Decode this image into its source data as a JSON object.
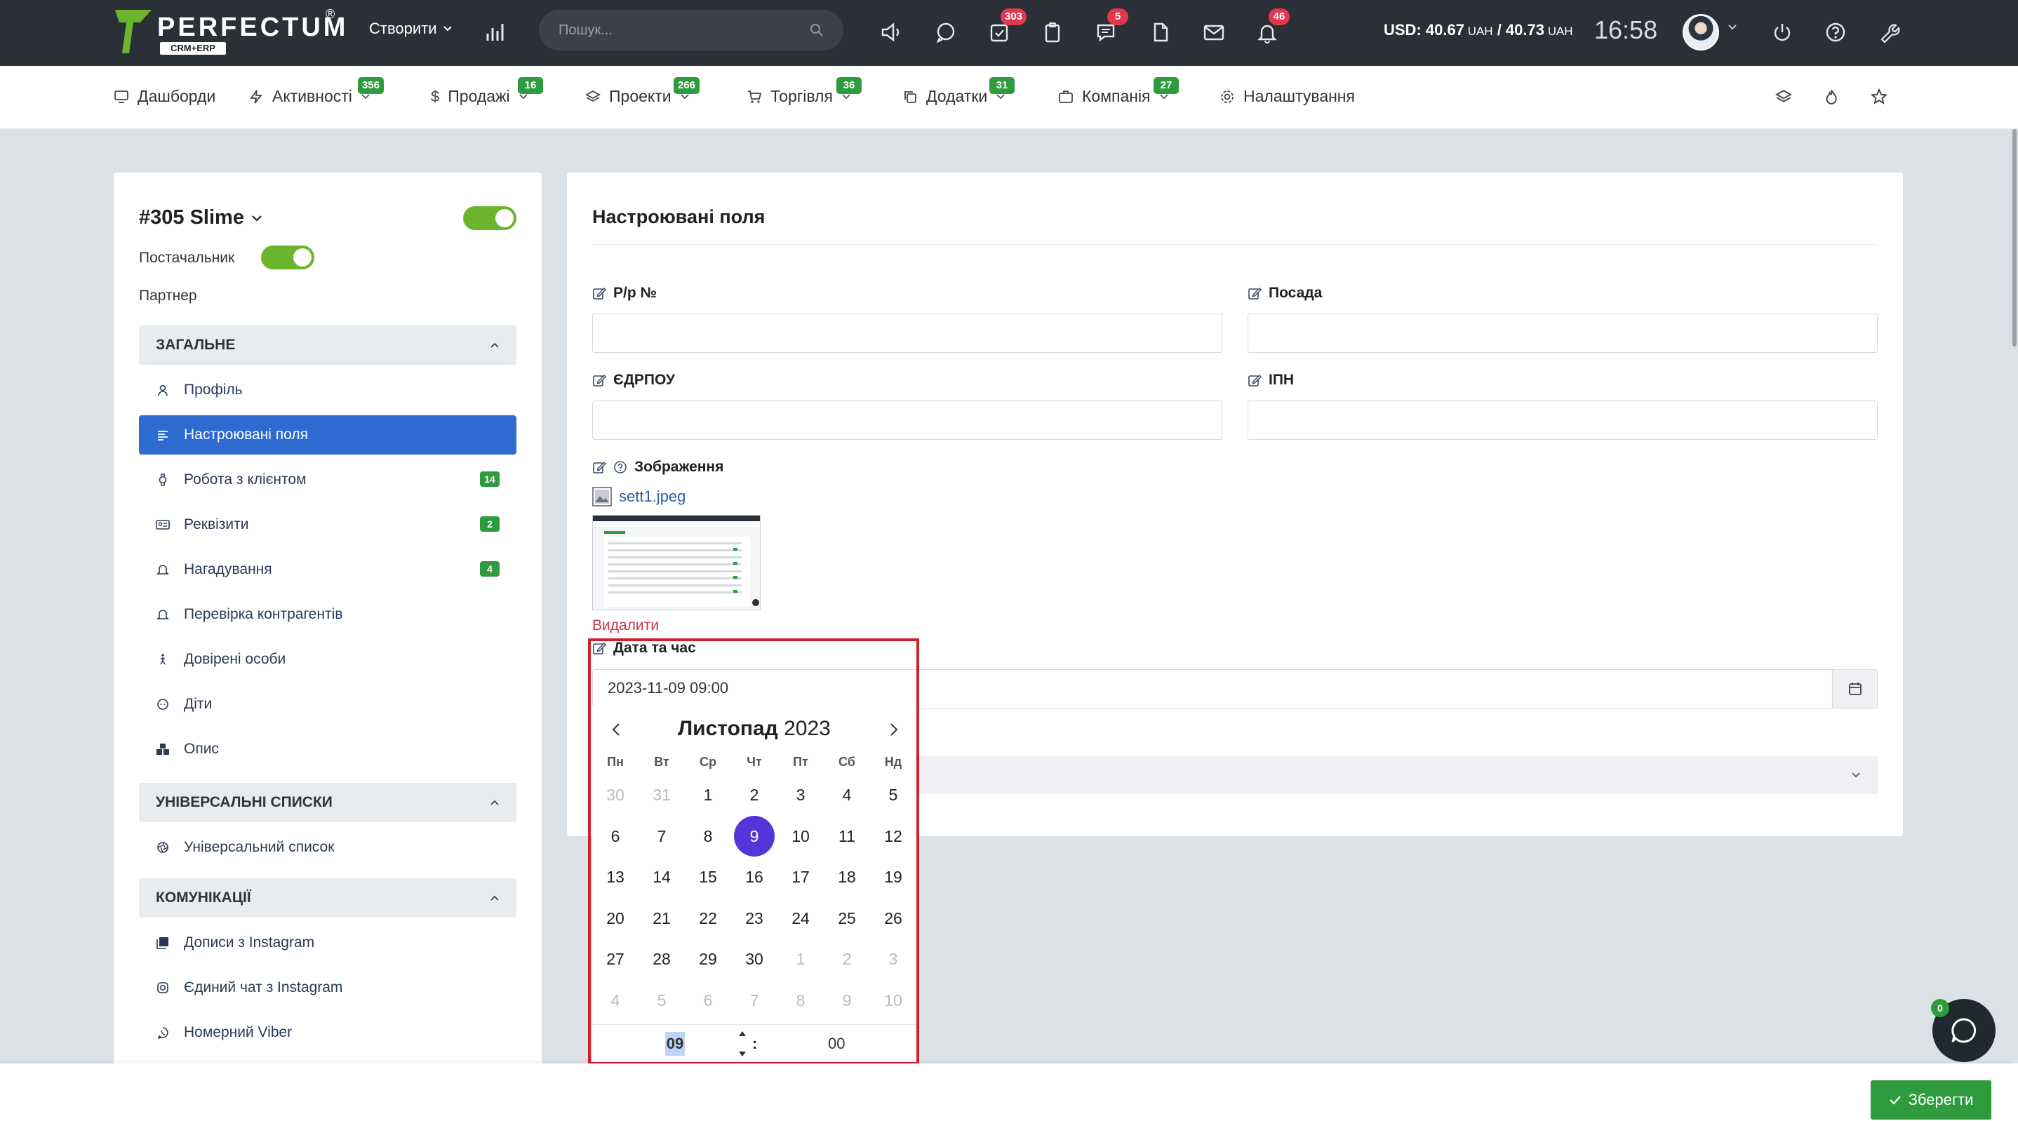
{
  "header": {
    "logo_text": "PERFECTUM",
    "logo_reg": "®",
    "logo_sub": "CRM+ERP",
    "create_label": "Створити",
    "search_placeholder": "Пошук...",
    "badges": {
      "tasks": "303",
      "chat": "5",
      "notifications": "46"
    },
    "rate_main": "USD: 40.67",
    "rate_unit1": " UAH",
    "rate_sep": " / 40.73",
    "rate_unit2": " UAH",
    "clock": "16:58"
  },
  "nav": {
    "items": [
      {
        "label": "Дашборди",
        "badge": ""
      },
      {
        "label": "Активності",
        "badge": "356"
      },
      {
        "label": "Продажі",
        "badge": "16"
      },
      {
        "label": "Проекти",
        "badge": "266"
      },
      {
        "label": "Торгівля",
        "badge": "36"
      },
      {
        "label": "Додатки",
        "badge": "31"
      },
      {
        "label": "Компанія",
        "badge": "27"
      },
      {
        "label": "Налаштування",
        "badge": ""
      }
    ]
  },
  "sidebar": {
    "title": "#305 Slime",
    "supplier_label": "Постачальник",
    "partner_label": "Партнер",
    "sections": [
      {
        "title": "ЗАГАЛЬНЕ"
      },
      {
        "title": "УНІВЕРСАЛЬНІ СПИСКИ"
      },
      {
        "title": "КОМУНІКАЦІЇ"
      }
    ],
    "general_items": [
      {
        "label": "Профіль",
        "count": ""
      },
      {
        "label": "Настроювані поля",
        "count": ""
      },
      {
        "label": "Робота з клієнтом",
        "count": "14"
      },
      {
        "label": "Реквізити",
        "count": "2"
      },
      {
        "label": "Нагадування",
        "count": "4"
      },
      {
        "label": "Перевірка контрагентів",
        "count": ""
      },
      {
        "label": "Довірені особи",
        "count": ""
      },
      {
        "label": "Діти",
        "count": ""
      },
      {
        "label": "Опис",
        "count": ""
      }
    ],
    "universal_items": [
      {
        "label": "Універсальний список"
      }
    ],
    "comm_items": [
      {
        "label": "Дописи з Instagram"
      },
      {
        "label": "Єдиний чат з Instagram"
      },
      {
        "label": "Номерний Viber"
      }
    ]
  },
  "main": {
    "title": "Настроювані поля",
    "fields": {
      "account_label": "Р/р №",
      "position_label": "Посада",
      "edrpou_label": "ЄДРПОУ",
      "ipn_label": "ІПН",
      "image_label": "Зображення",
      "image_file": "sett1.jpeg",
      "delete_label": "Видалити",
      "datetime_label": "Дата та час",
      "datetime_value": "2023-11-09 09:00"
    }
  },
  "datepicker": {
    "month": "Листопад",
    "year": "2023",
    "weekdays": [
      "Пн",
      "Вт",
      "Ср",
      "Чт",
      "Пт",
      "Сб",
      "Нд"
    ],
    "weeks": [
      [
        "30",
        "31",
        "1",
        "2",
        "3",
        "4",
        "5"
      ],
      [
        "6",
        "7",
        "8",
        "9",
        "10",
        "11",
        "12"
      ],
      [
        "13",
        "14",
        "15",
        "16",
        "17",
        "18",
        "19"
      ],
      [
        "20",
        "21",
        "22",
        "23",
        "24",
        "25",
        "26"
      ],
      [
        "27",
        "28",
        "29",
        "30",
        "1",
        "2",
        "3"
      ],
      [
        "4",
        "5",
        "6",
        "7",
        "8",
        "9",
        "10"
      ]
    ],
    "selected": "9",
    "hour": "09",
    "minute": "00",
    "colon": ":"
  },
  "footer": {
    "save_label": "Зберегти",
    "chat_badge": "0"
  },
  "colors": {
    "accent_green": "#2e9b3e",
    "accent_blue": "#2d6bd0",
    "selected_day": "#5335d8",
    "highlight_red": "#d51f2b"
  }
}
